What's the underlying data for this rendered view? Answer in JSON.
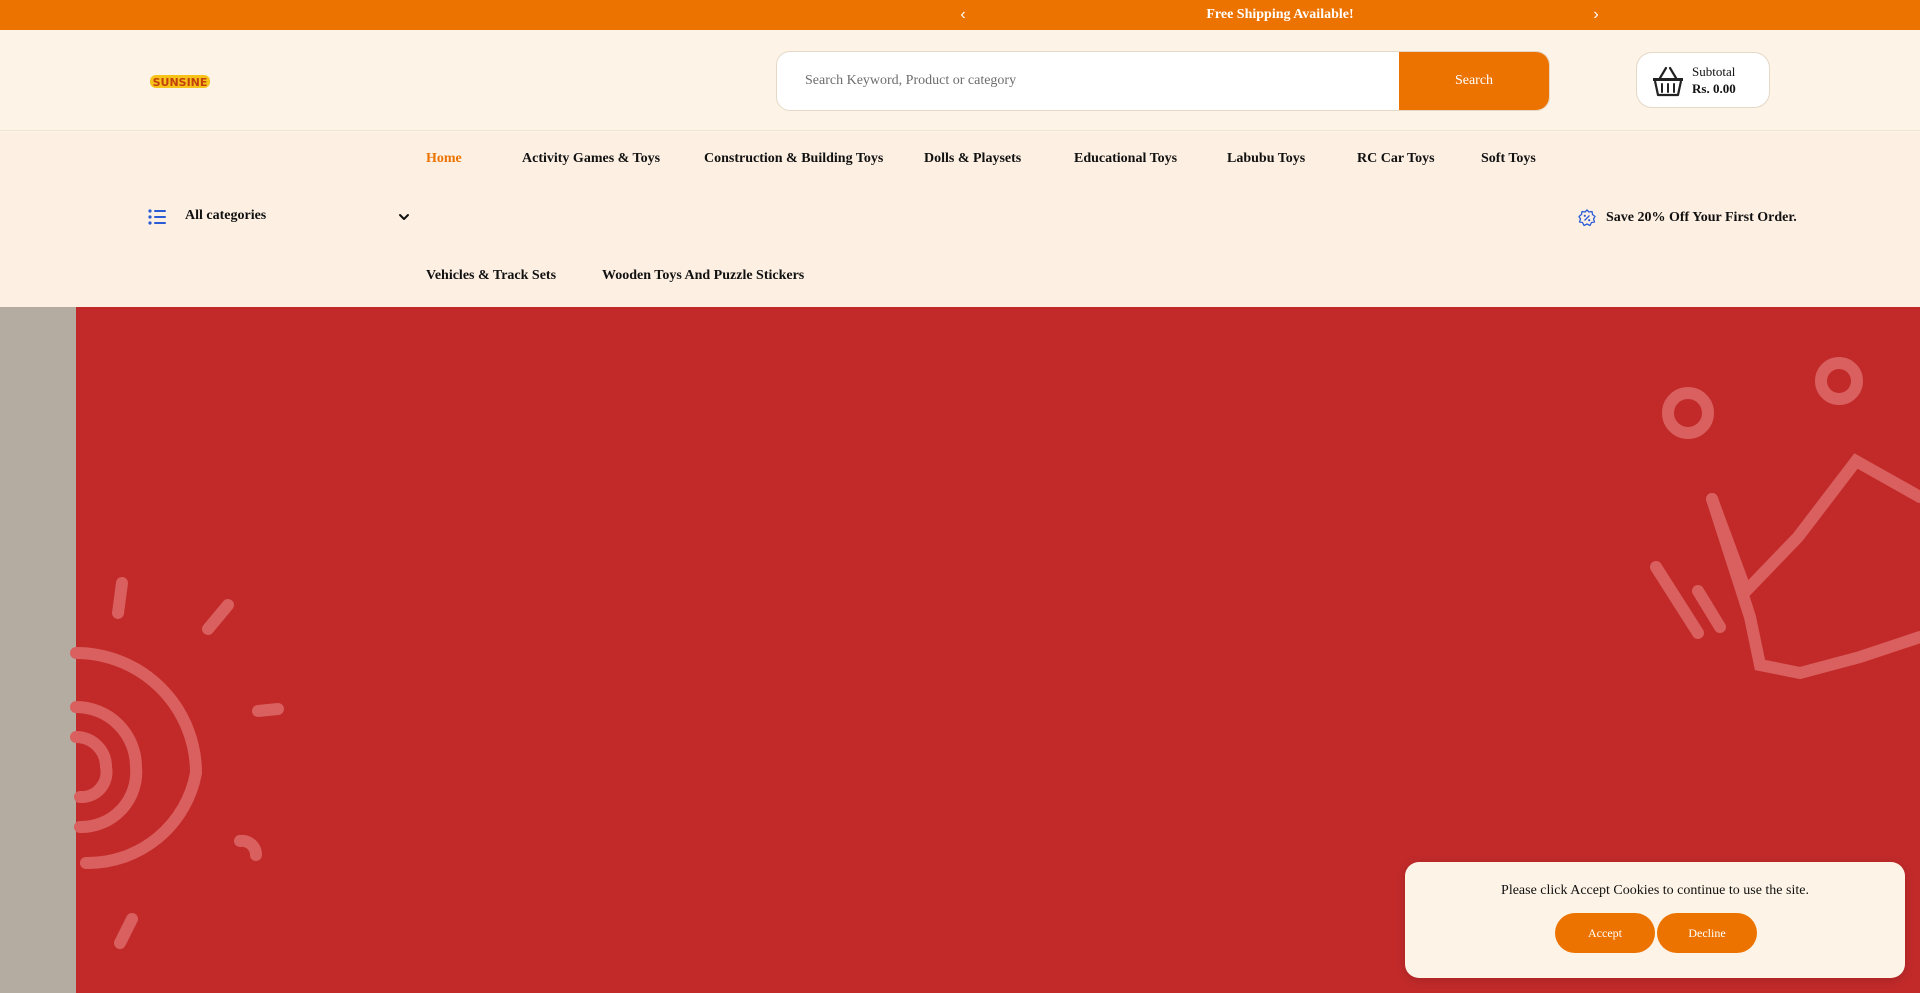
{
  "announcement": {
    "message": "Free Shipping Available!",
    "prev_icon": "chevron-left-icon",
    "next_icon": "chevron-right-icon"
  },
  "header": {
    "logo_text": "SUNSINE",
    "search": {
      "placeholder": "Search Keyword, Product or category",
      "button_label": "Search"
    },
    "cart": {
      "icon": "basket-icon",
      "subtotal_label": "Subtotal",
      "subtotal_value": "Rs. 0.00"
    }
  },
  "nav": {
    "categories_label": "All categories",
    "links": [
      {
        "label": "Home",
        "active": true
      },
      {
        "label": "Activity Games & Toys"
      },
      {
        "label": "Construction & Building Toys"
      },
      {
        "label": "Dolls & Playsets"
      },
      {
        "label": "Educational Toys"
      },
      {
        "label": "Labubu Toys"
      },
      {
        "label": "RC Car Toys"
      },
      {
        "label": "Soft Toys"
      },
      {
        "label": "Vehicles & Track Sets"
      },
      {
        "label": "Wooden Toys And Puzzle Stickers"
      }
    ],
    "promo_text": "Save 20% Off Your First Order."
  },
  "cookie": {
    "message": "Please click Accept Cookies to continue to use the site.",
    "accept_label": "Accept",
    "decline_label": "Decline"
  },
  "colors": {
    "accent": "#ec7300",
    "hero_bg": "#c22a2a",
    "page_bg": "#fdf3e6"
  }
}
